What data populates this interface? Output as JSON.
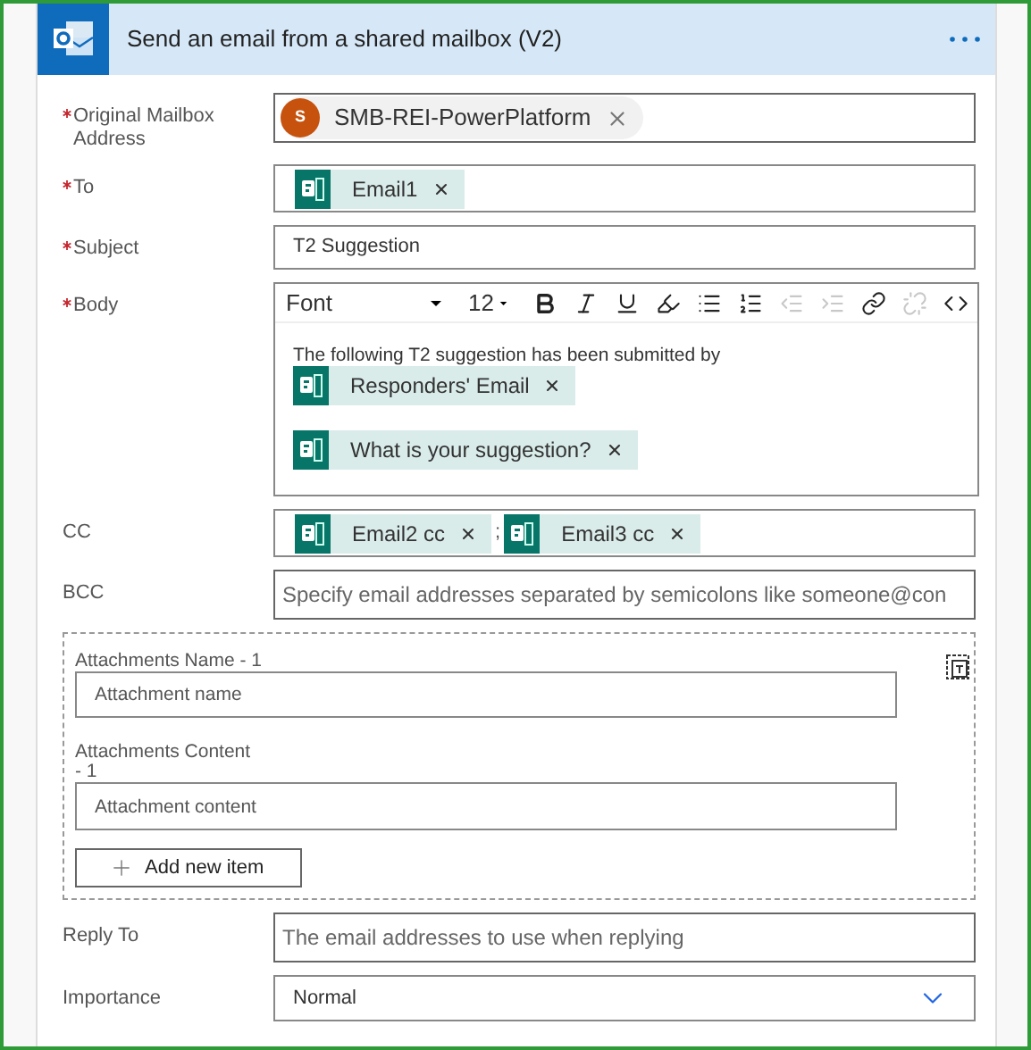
{
  "header": {
    "title": "Send an email from a shared mailbox (V2)"
  },
  "fields": [
    {
      "kind": "person",
      "label": "Original Mailbox Address",
      "required": true,
      "person": {
        "initial": "S",
        "name": "SMB-REI-PowerPlatform"
      }
    },
    {
      "kind": "tokens",
      "label": "To",
      "required": true,
      "tokens": [
        "Email1"
      ]
    },
    {
      "kind": "text",
      "label": "Subject",
      "required": true,
      "value": "T2 Suggestion"
    },
    {
      "kind": "body",
      "label": "Body",
      "required": true,
      "font": "Font",
      "size": "12",
      "toolbar": [
        {
          "kind": "bold",
          "disabled": false
        },
        {
          "kind": "italic",
          "disabled": false
        },
        {
          "kind": "underline",
          "disabled": false
        },
        {
          "kind": "highlight",
          "disabled": false
        },
        {
          "kind": "bullets",
          "disabled": false
        },
        {
          "kind": "numbers",
          "disabled": false
        },
        {
          "kind": "outdent",
          "disabled": true
        },
        {
          "kind": "indent",
          "disabled": true
        },
        {
          "kind": "link",
          "disabled": false
        },
        {
          "kind": "unlink",
          "disabled": true
        },
        {
          "kind": "code",
          "disabled": false
        }
      ],
      "text": "The following T2 suggestion has been submitted by",
      "tokens": [
        "Responders' Email",
        "What is your suggestion?"
      ]
    },
    {
      "kind": "tokens",
      "label": "CC",
      "required": false,
      "tokens": [
        "Email2 cc",
        "Email3 cc"
      ],
      "separator": ";"
    },
    {
      "kind": "input",
      "label": "BCC",
      "required": false,
      "placeholder": "Specify email addresses separated by semicolons like someone@con"
    }
  ],
  "attachments": {
    "items": [
      {
        "name_label": "Attachments Name - 1",
        "name_placeholder": "Attachment name",
        "content_label": "Attachments Content - 1",
        "content_placeholder": "Attachment content"
      }
    ],
    "add_button": "Add new item"
  },
  "fields_after": [
    {
      "kind": "input",
      "label": "Reply To",
      "required": false,
      "placeholder": "The email addresses to use when replying"
    },
    {
      "kind": "select",
      "label": "Importance",
      "required": false,
      "value": "Normal"
    }
  ]
}
